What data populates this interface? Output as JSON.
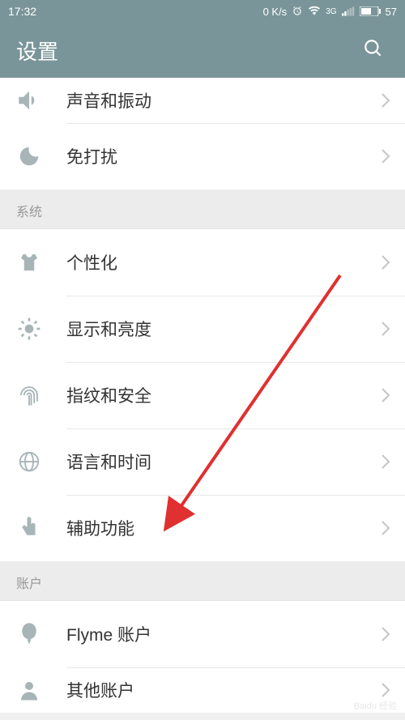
{
  "status": {
    "time": "17:32",
    "speed": "0 K/s",
    "network": "3G",
    "battery": "57"
  },
  "header": {
    "title": "设置"
  },
  "sections": {
    "s0": {
      "label": "系统"
    },
    "s1": {
      "label": "账户"
    }
  },
  "items": {
    "sound": "声音和振动",
    "dnd": "免打扰",
    "personalize": "个性化",
    "display": "显示和亮度",
    "fingerprint": "指纹和安全",
    "language": "语言和时间",
    "accessibility": "辅助功能",
    "flyme": "Flyme 账户",
    "other_account": "其他账户"
  }
}
